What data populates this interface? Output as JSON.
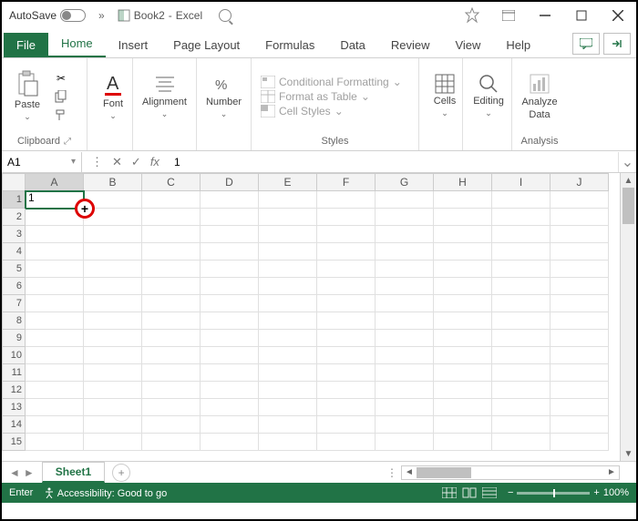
{
  "titlebar": {
    "autosave": "AutoSave",
    "book_name": "Book2",
    "app_name": "Excel"
  },
  "tabs": {
    "file": "File",
    "home": "Home",
    "insert": "Insert",
    "page_layout": "Page Layout",
    "formulas": "Formulas",
    "data": "Data",
    "review": "Review",
    "view": "View",
    "help": "Help"
  },
  "ribbon": {
    "clipboard": {
      "paste": "Paste",
      "label": "Clipboard"
    },
    "font": {
      "label": "Font"
    },
    "alignment": {
      "label": "Alignment"
    },
    "number": {
      "label": "Number"
    },
    "styles": {
      "conditional": "Conditional Formatting",
      "table": "Format as Table",
      "cellstyles": "Cell Styles",
      "label": "Styles"
    },
    "cells": {
      "label": "Cells"
    },
    "editing": {
      "label": "Editing"
    },
    "analyze": {
      "label1": "Analyze",
      "label2": "Data",
      "group": "Analysis"
    }
  },
  "namebox": {
    "ref": "A1"
  },
  "formula": {
    "value": "1"
  },
  "columns": [
    "A",
    "B",
    "C",
    "D",
    "E",
    "F",
    "G",
    "H",
    "I",
    "J"
  ],
  "rows": [
    "1",
    "2",
    "3",
    "4",
    "5",
    "6",
    "7",
    "8",
    "9",
    "10",
    "11",
    "12",
    "13",
    "14",
    "15"
  ],
  "cells": {
    "A1": "1"
  },
  "sheet": {
    "name": "Sheet1"
  },
  "status": {
    "mode": "Enter",
    "accessibility": "Accessibility: Good to go",
    "zoom": "100%"
  }
}
